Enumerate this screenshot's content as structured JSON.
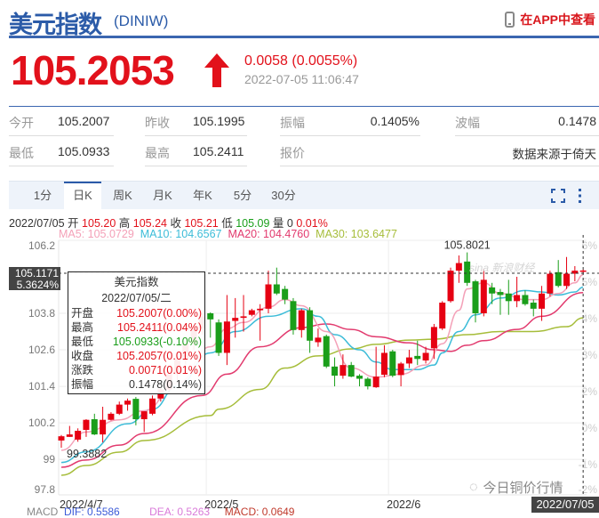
{
  "header": {
    "title": "美元指数",
    "code": "(DINIW)",
    "app_link": "在APP中查看"
  },
  "quote": {
    "price": "105.2053",
    "change": "0.0058 (0.0055%)",
    "timestamp": "2022-07-05 11:06:47",
    "direction": "up"
  },
  "stats": [
    {
      "label": "今开",
      "value": "105.2007"
    },
    {
      "label": "昨收",
      "value": "105.1995"
    },
    {
      "label": "振幅",
      "value": "0.1405%"
    },
    {
      "label": "波幅",
      "value": "0.1478"
    },
    {
      "label": "最低",
      "value": "105.0933"
    },
    {
      "label": "最高",
      "value": "105.2411"
    },
    {
      "label": "报价",
      "value": ""
    },
    {
      "label": "",
      "value": "数据来源于倚天"
    }
  ],
  "tabs": [
    "1分",
    "日K",
    "周K",
    "月K",
    "年K",
    "5分",
    "30分"
  ],
  "active_tab": "日K",
  "info": {
    "date": "2022/07/05",
    "open_label": "开",
    "open": "105.20",
    "high_label": "高",
    "high": "105.24",
    "close_label": "收",
    "close": "105.21",
    "low_label": "低",
    "low": "105.09",
    "vol_label": "量",
    "vol": "0",
    "pct": "0.01%"
  },
  "ma_legend": {
    "ma5": "MA5: 105.0729",
    "ma10": "MA10: 104.6567",
    "ma20": "MA20: 104.4760",
    "ma30": "MA30: 103.6477"
  },
  "crosshair": {
    "price": "105.1171",
    "pct": "5.3624%",
    "date": "2022/07/05"
  },
  "tooltip": {
    "title": "美元指数",
    "date": "2022/07/05/二",
    "rows": [
      {
        "label": "开盘",
        "value": "105.2007(0.00%)",
        "tone": "red"
      },
      {
        "label": "最高",
        "value": "105.2411(0.04%)",
        "tone": "red"
      },
      {
        "label": "最低",
        "value": "105.0933(-0.10%)",
        "tone": "green"
      },
      {
        "label": "收盘",
        "value": "105.2057(0.01%)",
        "tone": "red"
      },
      {
        "label": "涨跌",
        "value": "0.0071(0.01%)",
        "tone": "red"
      },
      {
        "label": "振幅",
        "value": "0.1478(0.14%)",
        "tone": "dark"
      }
    ]
  },
  "watermarks": {
    "sina": "sina 新浪财经",
    "wechat": "今日铜价行情"
  },
  "macd": {
    "label": "MACD",
    "dif": "DIF: 0.5586",
    "dea": "DEA: 0.5263",
    "macd": "MACD: 0.0649"
  },
  "colors": {
    "up": "#e60012",
    "down": "#1a9e1a",
    "ma5": "#f4a1b8",
    "ma10": "#3cbcd8",
    "ma20": "#e23a6e",
    "ma30": "#a6bd3a",
    "brand": "#2b5ba8"
  },
  "chart_data": {
    "type": "candlestick",
    "y_ticks": [
      "106.2",
      "103.8",
      "102.6",
      "101.4",
      "100.2",
      "99",
      "97.8"
    ],
    "y_tick_values": [
      106.2,
      103.8,
      102.6,
      101.4,
      100.2,
      99,
      97.8
    ],
    "right_ticks": [
      "6%",
      "5%",
      "4%",
      "3%",
      "2%",
      "0%",
      "-1%",
      "-2%"
    ],
    "x_ticks": [
      {
        "label": "2022/4/7",
        "index": 0
      },
      {
        "label": "2022/5",
        "index": 17.5
      },
      {
        "label": "2022/6",
        "index": 39.5
      }
    ],
    "ylim": [
      97.8,
      106.2
    ],
    "max_label": {
      "text": "105.8021",
      "index": 49
    },
    "min_label": {
      "text": "99.3882",
      "index": 0
    },
    "crosshair_value": 105.1171,
    "ohlc": [
      [
        99.62,
        99.8,
        99.38,
        99.76
      ],
      [
        99.74,
        100.1,
        99.74,
        99.82
      ],
      [
        99.65,
        100.02,
        99.58,
        99.94
      ],
      [
        99.97,
        100.32,
        99.74,
        100.3
      ],
      [
        100.32,
        100.5,
        99.8,
        99.82
      ],
      [
        99.82,
        100.73,
        99.56,
        100.3
      ],
      [
        100.3,
        100.55,
        100.28,
        100.5
      ],
      [
        100.5,
        100.9,
        100.46,
        100.8
      ],
      [
        100.8,
        101.0,
        100.6,
        100.93
      ],
      [
        100.99,
        101.05,
        100.12,
        100.32
      ],
      [
        100.32,
        100.58,
        99.9,
        100.58
      ],
      [
        100.5,
        101.1,
        100.45,
        101.0
      ],
      [
        101.0,
        101.35,
        100.9,
        101.3
      ],
      [
        101.3,
        101.9,
        101.2,
        101.8
      ],
      [
        101.8,
        102.4,
        101.6,
        102.3
      ],
      [
        102.3,
        102.9,
        102.1,
        102.8
      ],
      [
        102.8,
        103.4,
        102.6,
        103.3
      ],
      [
        103.3,
        103.8,
        103.1,
        103.7
      ],
      [
        103.8,
        103.83,
        103.0,
        103.6
      ],
      [
        103.5,
        103.6,
        102.4,
        102.5
      ],
      [
        102.5,
        104.4,
        102.1,
        103.53
      ],
      [
        103.55,
        104.3,
        103.0,
        103.65
      ],
      [
        103.65,
        104.4,
        103.2,
        103.7
      ],
      [
        103.75,
        103.95,
        103.7,
        103.9
      ],
      [
        103.9,
        104.1,
        102.9,
        103.95
      ],
      [
        103.95,
        105.2,
        103.8,
        104.75
      ],
      [
        104.75,
        105.3,
        104.4,
        104.45
      ],
      [
        104.6,
        104.7,
        104.1,
        104.25
      ],
      [
        104.2,
        104.3,
        103.1,
        103.25
      ],
      [
        103.25,
        103.95,
        103.0,
        103.9
      ],
      [
        103.9,
        104.0,
        102.5,
        102.9
      ],
      [
        102.85,
        103.3,
        102.7,
        103.0
      ],
      [
        103.05,
        103.1,
        102.0,
        102.05
      ],
      [
        102.05,
        102.35,
        101.4,
        101.75
      ],
      [
        101.75,
        102.45,
        101.65,
        102.1
      ],
      [
        102.1,
        102.2,
        101.7,
        101.72
      ],
      [
        101.75,
        101.8,
        101.4,
        101.65
      ],
      [
        101.65,
        101.7,
        101.3,
        101.4
      ],
      [
        101.37,
        102.7,
        101.35,
        101.72
      ],
      [
        101.78,
        102.75,
        101.7,
        102.5
      ],
      [
        102.55,
        102.6,
        101.7,
        101.75
      ],
      [
        101.77,
        102.2,
        101.4,
        102.15
      ],
      [
        102.15,
        102.6,
        102.0,
        102.35
      ],
      [
        102.4,
        102.9,
        102.1,
        102.3
      ],
      [
        102.25,
        102.7,
        102.15,
        102.5
      ],
      [
        102.65,
        103.45,
        102.3,
        103.35
      ],
      [
        103.3,
        104.2,
        103.25,
        104.15
      ],
      [
        104.2,
        105.3,
        104.15,
        105.2
      ],
      [
        105.2,
        105.7,
        104.8,
        105.45
      ],
      [
        105.5,
        105.8,
        104.7,
        104.8
      ],
      [
        104.85,
        104.9,
        103.5,
        103.8
      ],
      [
        103.8,
        105.25,
        103.7,
        104.9
      ],
      [
        104.65,
        104.8,
        104.1,
        104.45
      ],
      [
        104.5,
        104.6,
        103.75,
        104.4
      ],
      [
        104.45,
        104.9,
        103.75,
        104.2
      ],
      [
        104.2,
        105.0,
        104.0,
        104.4
      ],
      [
        104.4,
        104.55,
        104.05,
        104.1
      ],
      [
        104.15,
        104.25,
        103.7,
        103.95
      ],
      [
        103.95,
        104.7,
        103.55,
        104.45
      ],
      [
        104.45,
        105.2,
        104.35,
        105.1
      ],
      [
        105.15,
        105.55,
        104.65,
        104.7
      ],
      [
        104.7,
        105.65,
        104.6,
        105.1
      ],
      [
        105.1,
        105.35,
        104.85,
        105.2
      ],
      [
        105.2007,
        105.2411,
        105.0933,
        105.2057
      ]
    ],
    "series": [
      {
        "name": "MA5",
        "points": [
          [
            0,
            99.3
          ],
          [
            3,
            99.9
          ],
          [
            7,
            100.3
          ],
          [
            10,
            100.6
          ],
          [
            14,
            101.5
          ],
          [
            18,
            102.7
          ],
          [
            20,
            103.3
          ],
          [
            22,
            103.5
          ],
          [
            25,
            104.0
          ],
          [
            27,
            104.25
          ],
          [
            29,
            104.05
          ],
          [
            32,
            103.2
          ],
          [
            35,
            102.0
          ],
          [
            38,
            101.7
          ],
          [
            41,
            101.8
          ],
          [
            44,
            102.1
          ],
          [
            46,
            102.8
          ],
          [
            48,
            103.9
          ],
          [
            49,
            104.6
          ],
          [
            51,
            104.8
          ],
          [
            53,
            104.45
          ],
          [
            56,
            104.25
          ],
          [
            58,
            104.25
          ],
          [
            60,
            104.45
          ],
          [
            62,
            104.8
          ],
          [
            63,
            105.07
          ]
        ]
      },
      {
        "name": "MA10",
        "points": [
          [
            0,
            98.9
          ],
          [
            3,
            99.25
          ],
          [
            8,
            100.17
          ],
          [
            11,
            100.65
          ],
          [
            14,
            101.4
          ],
          [
            18,
            102.5
          ],
          [
            21,
            103.2
          ],
          [
            25,
            103.7
          ],
          [
            29,
            103.95
          ],
          [
            31,
            103.7
          ],
          [
            33,
            103.1
          ],
          [
            36,
            102.6
          ],
          [
            38,
            102.2
          ],
          [
            40,
            101.95
          ],
          [
            43,
            101.95
          ],
          [
            45,
            102.1
          ],
          [
            46,
            102.5
          ],
          [
            48,
            103.2
          ],
          [
            50,
            103.75
          ],
          [
            53,
            104.3
          ],
          [
            56,
            104.55
          ],
          [
            58,
            104.5
          ],
          [
            60,
            104.4
          ],
          [
            62,
            104.5
          ],
          [
            63,
            104.66
          ]
        ]
      },
      {
        "name": "MA20",
        "points": [
          [
            0,
            98.74
          ],
          [
            3,
            98.98
          ],
          [
            7,
            99.47
          ],
          [
            10,
            99.85
          ],
          [
            17,
            101.1
          ],
          [
            20,
            101.8
          ],
          [
            24,
            102.7
          ],
          [
            29,
            103.33
          ],
          [
            32,
            103.45
          ],
          [
            35,
            103.27
          ],
          [
            38,
            103.03
          ],
          [
            42,
            102.83
          ],
          [
            45,
            102.6
          ],
          [
            47,
            102.55
          ],
          [
            49,
            102.75
          ],
          [
            51,
            102.9
          ],
          [
            55,
            103.27
          ],
          [
            58,
            103.7
          ],
          [
            63,
            104.48
          ]
        ]
      },
      {
        "name": "MA30",
        "points": [
          [
            0,
            98.48
          ],
          [
            3,
            98.8
          ],
          [
            7,
            99.24
          ],
          [
            10,
            99.62
          ],
          [
            18,
            100.44
          ],
          [
            19,
            100.65
          ],
          [
            24,
            101.3
          ],
          [
            27,
            102.0
          ],
          [
            31,
            102.4
          ],
          [
            35,
            102.63
          ],
          [
            38,
            102.78
          ],
          [
            42,
            102.92
          ],
          [
            45,
            102.95
          ],
          [
            49,
            103.1
          ],
          [
            53,
            103.2
          ],
          [
            57,
            103.2
          ],
          [
            61,
            103.36
          ],
          [
            63,
            103.65
          ]
        ]
      }
    ]
  }
}
